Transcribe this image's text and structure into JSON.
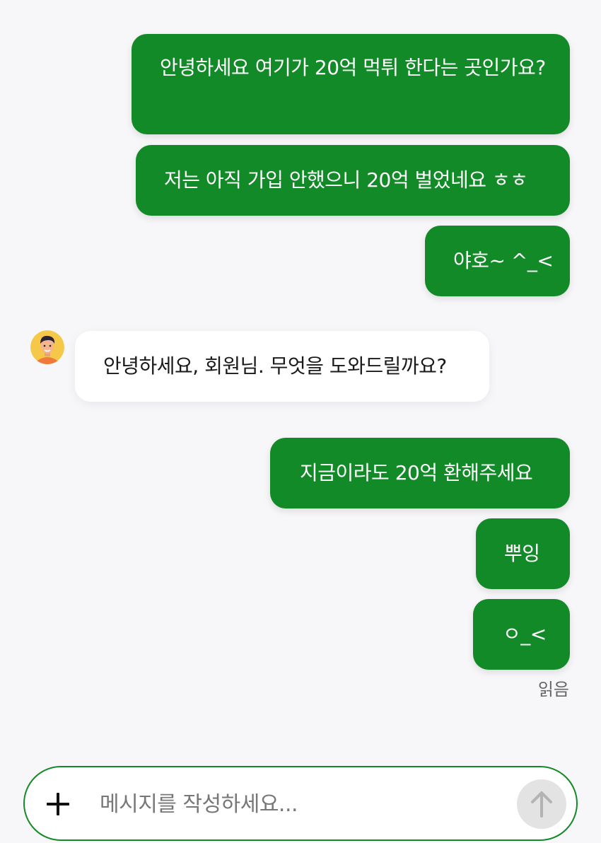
{
  "messages": [
    {
      "sender": "me",
      "text": "안녕하세요 여기가 20억 먹튀 한다는 곳인가요?"
    },
    {
      "sender": "me",
      "text": "저는 아직 가입 안했으니 20억 벌었네요 ㅎㅎ"
    },
    {
      "sender": "me",
      "text": "야호~ ^_<"
    },
    {
      "sender": "agent",
      "text": "안녕하세요, 회원님. 무엇을 도와드릴까요?"
    },
    {
      "sender": "me",
      "text": "지금이라도 20억 환해주세요"
    },
    {
      "sender": "me",
      "text": "뿌잉"
    },
    {
      "sender": "me",
      "text": "ㅇ_<"
    }
  ],
  "read_receipt": "읽음",
  "composer": {
    "placeholder": "메시지를 작성하세요...",
    "add_icon": "plus-icon",
    "send_icon": "arrow-up-icon"
  },
  "colors": {
    "outgoing_bubble": "#138a28",
    "incoming_bubble": "#ffffff",
    "background": "#f7f6f8",
    "send_button": "#e3e3e3"
  }
}
